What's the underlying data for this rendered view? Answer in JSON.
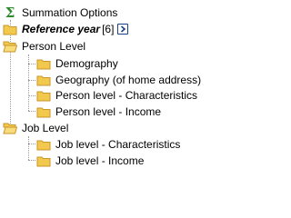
{
  "tree": {
    "items": [
      {
        "label": "Summation Options",
        "icon": "sigma-icon"
      },
      {
        "label": "Reference year",
        "count": "[6]",
        "icon": "folder-icon",
        "action": "expand-arrow-icon"
      },
      {
        "label": "Person Level",
        "icon": "open-folder-icon"
      },
      {
        "label": "Demography",
        "icon": "folder-icon"
      },
      {
        "label": "Geography (of home address)",
        "icon": "folder-icon"
      },
      {
        "label": "Person level - Characteristics",
        "icon": "folder-icon"
      },
      {
        "label": "Person level - Income",
        "icon": "folder-icon"
      },
      {
        "label": "Job Level",
        "icon": "open-folder-icon"
      },
      {
        "label": "Job level - Characteristics",
        "icon": "folder-icon"
      },
      {
        "label": "Job level - Income",
        "icon": "folder-icon"
      }
    ]
  },
  "colors": {
    "folder_fill": "#f2c94c",
    "folder_stroke": "#c9962a",
    "sigma": "#2e8b2e",
    "expand_button": "#1c3f8a"
  }
}
